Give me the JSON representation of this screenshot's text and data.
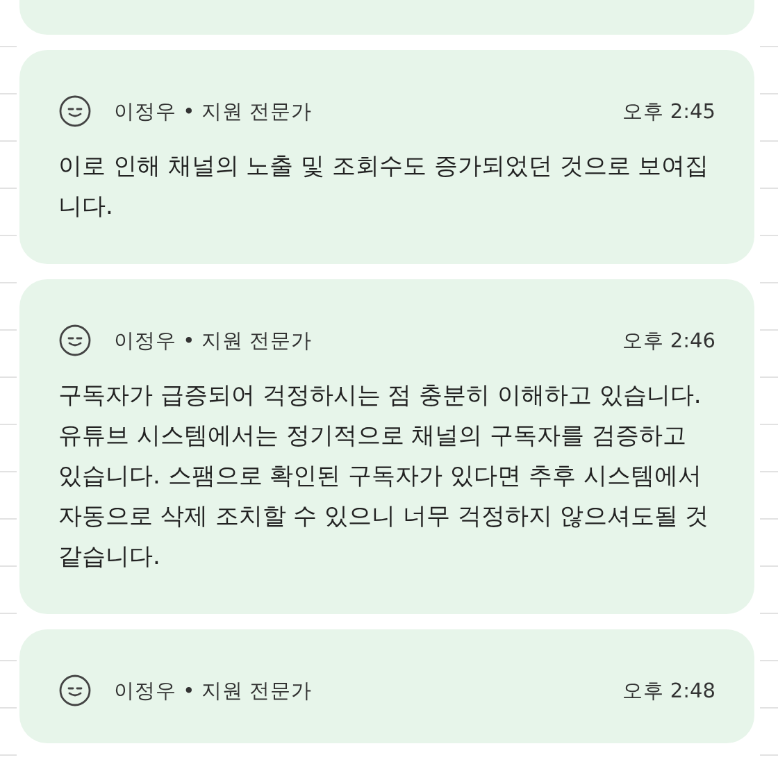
{
  "messages": [
    {
      "author": "이정우 • 지원 전문가",
      "time": "오후 2:45",
      "text": "이로 인해 채널의 노출 및 조회수도 증가되었던 것으로 보여집니다."
    },
    {
      "author": "이정우 • 지원 전문가",
      "time": "오후 2:46",
      "text": "구독자가 급증되어 걱정하시는 점 충분히 이해하고 있습니다. 유튜브 시스템에서는 정기적으로 채널의 구독자를 검증하고 있습니다. 스팸으로 확인된 구독자가 있다면 추후 시스템에서 자동으로 삭제 조치할 수 있으니 너무 걱정하지 않으셔도될 것 같습니다."
    },
    {
      "author": "이정우 • 지원 전문가",
      "time": "오후 2:48"
    }
  ]
}
